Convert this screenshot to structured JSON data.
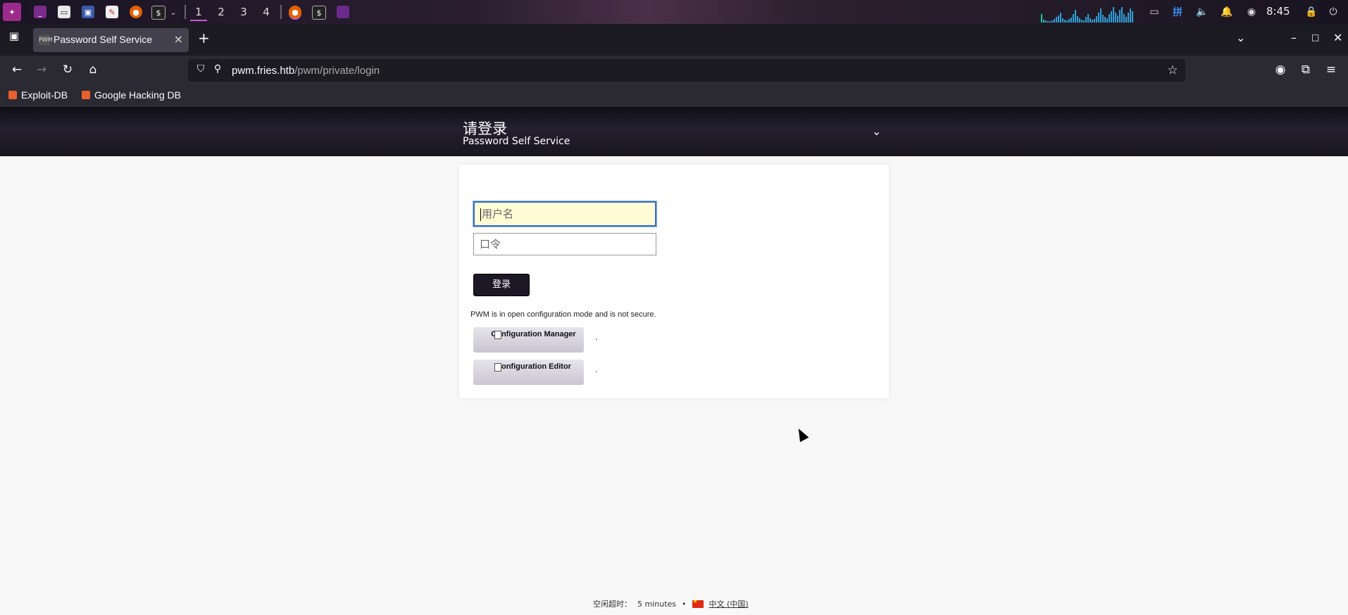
{
  "taskbar": {
    "workspaces": [
      "1",
      "2",
      "3",
      "4"
    ],
    "clock": "8:45"
  },
  "browser": {
    "tab_title": "Password Self Service",
    "tab_favicon_text": "PWM",
    "url_host": "pwm.fries.htb",
    "url_path": "/pwm/private/login",
    "bookmarks": [
      "Exploit-DB",
      "Google Hacking DB"
    ]
  },
  "header": {
    "title": "请登录",
    "subtitle": "Password Self Service"
  },
  "login": {
    "username_placeholder": "用户名",
    "password_placeholder": "口令",
    "login_button": "登录",
    "notice": "PWM is in open configuration mode and is not secure.",
    "config_manager_label": "Configuration Manager",
    "config_editor_label": "Configuration Editor",
    "dot": "."
  },
  "footer": {
    "idle_label": "空闲超时：",
    "idle_value": "5 minutes",
    "separator": "•",
    "locale": "中文 (中国)"
  },
  "colors": {
    "header_bg": "#1e1b28",
    "input_focus_bg": "#fffbd5",
    "input_focus_border": "#3a6fbf",
    "login_button_bg": "#1c1826",
    "taskbar_accent": "#c45cd0"
  }
}
